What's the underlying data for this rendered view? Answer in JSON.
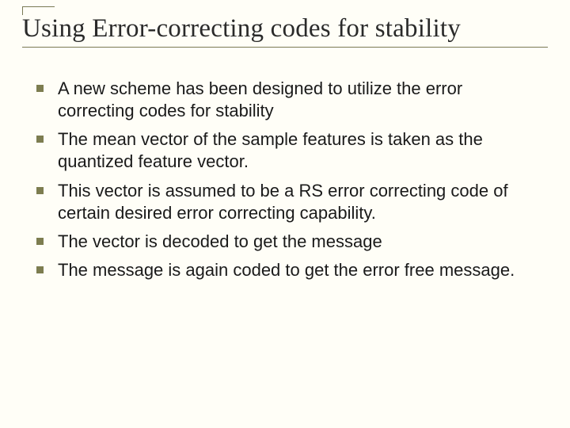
{
  "title": "Using Error-correcting codes for stability",
  "bullets": [
    "A new scheme has been designed to utilize the error correcting codes for stability",
    "The mean vector of the sample features is taken as the quantized feature vector.",
    "This vector is assumed to be a RS error correcting code of certain desired error correcting capability.",
    "The vector is decoded to get the message",
    "The message is again coded to get the error free message."
  ]
}
